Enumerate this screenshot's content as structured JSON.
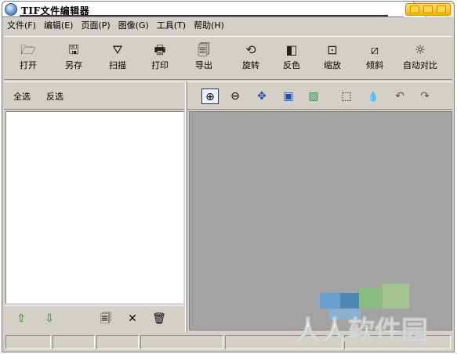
{
  "window": {
    "title": "TIF文件编辑器"
  },
  "menu": [
    "文件(F)",
    "编辑(E)",
    "页面(P)",
    "图像(G)",
    "工具(T)",
    "帮助(H)"
  ],
  "toolbar": [
    {
      "label": "打开",
      "icon": "folder-open-icon",
      "glyph": "🗁"
    },
    {
      "label": "另存",
      "icon": "floppy-disk-icon",
      "glyph": "🖫"
    },
    {
      "label": "扫描",
      "icon": "scanner-icon",
      "glyph": "⛛"
    },
    {
      "label": "打印",
      "icon": "printer-icon",
      "glyph": "🖶"
    },
    {
      "label": "导出",
      "icon": "export-icon",
      "glyph": "🗐"
    },
    {
      "label": "旋转",
      "icon": "rotate-icon",
      "glyph": "⟲"
    },
    {
      "label": "反色",
      "icon": "invert-color-icon",
      "glyph": "◧"
    },
    {
      "label": "缩放",
      "icon": "resize-icon",
      "glyph": "⊡"
    },
    {
      "label": "倾斜",
      "icon": "skew-icon",
      "glyph": "⧄"
    },
    {
      "label": "自动对比",
      "icon": "auto-contrast-icon",
      "glyph": "☼"
    }
  ],
  "list_panel": {
    "select_all": "全选",
    "select_invert": "反选"
  },
  "view_toolbar": [
    {
      "icon": "zoom-in-icon",
      "glyph": "⊕"
    },
    {
      "icon": "zoom-out-icon",
      "glyph": "⊖"
    },
    {
      "icon": "fit-to-window-icon",
      "glyph": "✥"
    },
    {
      "icon": "actual-size-icon",
      "glyph": "▣"
    },
    {
      "icon": "image-view-icon",
      "glyph": "▨"
    },
    {
      "icon": "rectangle-select-icon",
      "glyph": "⬚"
    },
    {
      "icon": "color-dropper-icon",
      "glyph": "💧"
    },
    {
      "icon": "undo-icon",
      "glyph": "↶"
    },
    {
      "icon": "redo-icon",
      "glyph": "↷"
    }
  ],
  "list_footer": [
    {
      "icon": "move-up-icon",
      "glyph": "⇧"
    },
    {
      "icon": "move-down-icon",
      "glyph": "⇩"
    },
    {
      "icon": "copy-page-icon",
      "glyph": "🗐"
    },
    {
      "icon": "delete-icon",
      "glyph": "✕"
    },
    {
      "icon": "trash-icon",
      "glyph": "🗑"
    }
  ],
  "status_cells": 6,
  "watermark": "人人软件园",
  "colors": {
    "view_bg": "#a3a3a3",
    "window_bg": "#d4d0c8",
    "title_buttons": "#f5b400"
  }
}
